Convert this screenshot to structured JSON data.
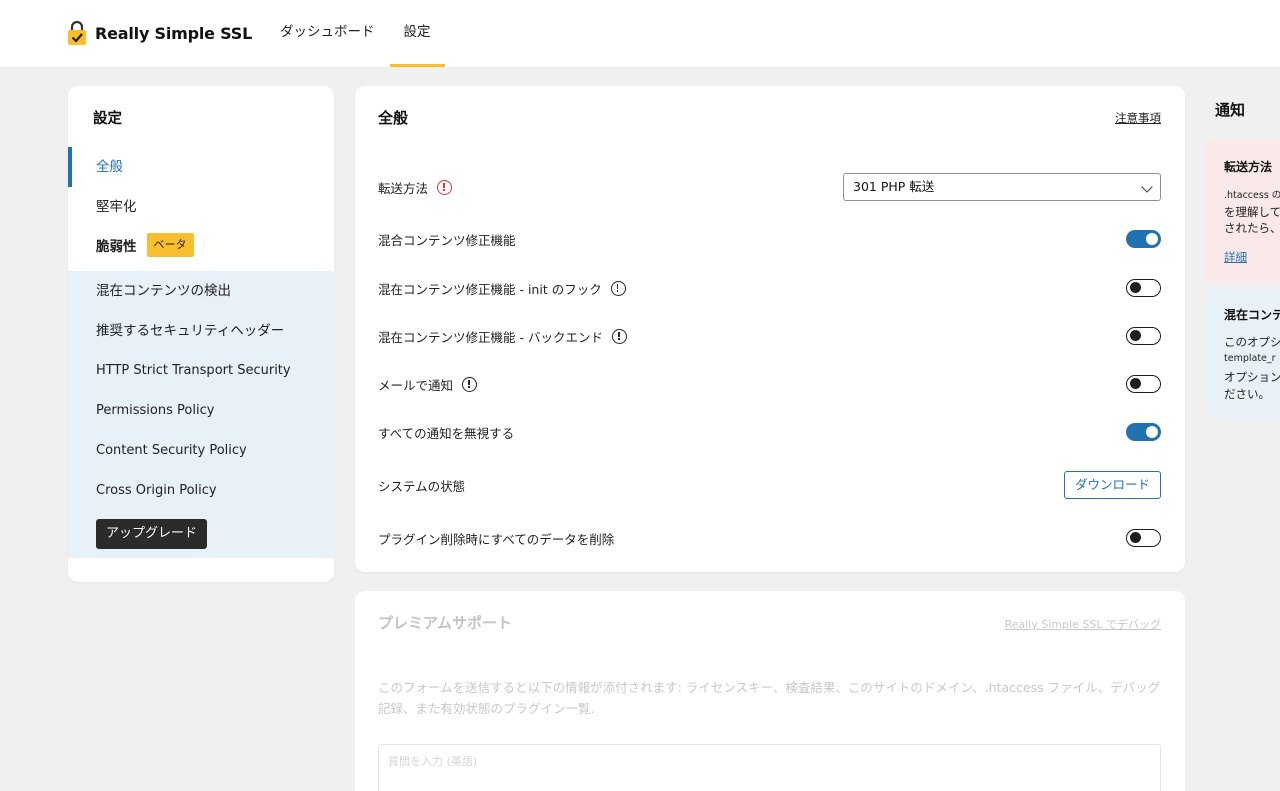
{
  "header": {
    "brand_name": "Really Simple SSL",
    "nav": [
      {
        "label": "ダッシュボード"
      },
      {
        "label": "設定"
      }
    ]
  },
  "sidebar": {
    "title": "設定",
    "items": [
      {
        "label": "全般"
      },
      {
        "label": "堅牢化"
      },
      {
        "label": "脆弱性",
        "badge": "ベータ"
      }
    ],
    "sub_items": [
      {
        "label": "混在コンテンツの検出"
      },
      {
        "label": "推奨するセキュリティヘッダー"
      },
      {
        "label": "HTTP Strict Transport Security"
      },
      {
        "label": "Permissions Policy"
      },
      {
        "label": "Content Security Policy"
      },
      {
        "label": "Cross Origin Policy"
      }
    ],
    "upgrade_label": "アップグレード"
  },
  "main": {
    "title": "全般",
    "notes_link": "注意事項",
    "redirect_label": "転送方法",
    "redirect_value": "301 PHP 転送",
    "rows": [
      {
        "label": "混合コンテンツ修正機能",
        "state": "on"
      },
      {
        "label": "混在コンテンツ修正機能 - init のフック",
        "state": "off"
      },
      {
        "label": "混在コンテンツ修正機能 - バックエンド",
        "state": "off"
      },
      {
        "label": "メールで通知",
        "state": "off"
      },
      {
        "label": "すべての通知を無視する",
        "state": "on"
      }
    ],
    "system_status_label": "システムの状態",
    "download_label": "ダウンロード",
    "delete_data_label": "プラグイン削除時にすべてのデータを削除",
    "delete_data_state": "off"
  },
  "premium": {
    "title": "プレミアムサポート",
    "debug_link": "Really Simple SSL でデバッグ",
    "text_line1": "このフォームを送信すると以下の情報が添付されます: ライセンスキー、検査結果、このサイトのドメイン、.htaccess ファイル、デバッグ",
    "text_line2": "記録、また有効状態のプラグイン一覧.",
    "textarea_placeholder": "質問を入力 (英語)"
  },
  "notices": {
    "title": "通知",
    "notice1": {
      "title": "転送方法",
      "line1": ".htaccess の",
      "line2": "を理解して",
      "line3": "されたら、",
      "link": "詳細"
    },
    "notice2": {
      "title": "混在コンテ",
      "line1": "このオプシ",
      "line2": "template_r",
      "line3": "オプション",
      "line4": "ださい。"
    }
  },
  "colors": {
    "accent": "#2271b1",
    "brand_yellow": "#f8be2e",
    "warning_red": "#d63638",
    "notice_pink": "#fbe9ea",
    "notice_blue": "#e8f0f8"
  }
}
